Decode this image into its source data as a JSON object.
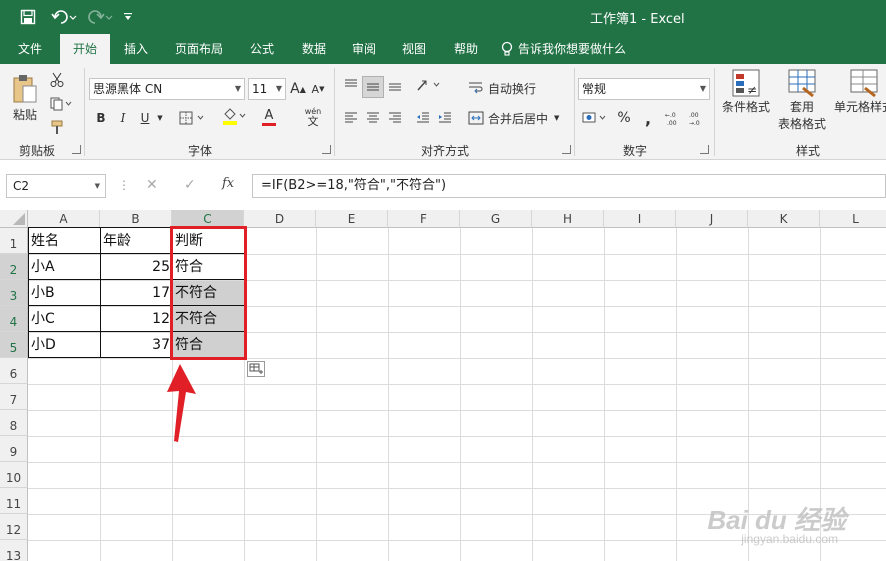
{
  "window": {
    "title": "工作簿1  -  Excel",
    "accent": "#217346",
    "highlight": "#e01f27"
  },
  "tabs": [
    "文件",
    "开始",
    "插入",
    "页面布局",
    "公式",
    "数据",
    "审阅",
    "视图",
    "帮助"
  ],
  "tell_me": "告诉我你想要做什么",
  "ribbon": {
    "clipboard": {
      "paste": "粘贴",
      "group": "剪贴板"
    },
    "font": {
      "name": "思源黑体 CN",
      "size": "11",
      "bold": "B",
      "italic": "I",
      "underline": "U",
      "group": "字体",
      "grow": "A",
      "shrink": "A",
      "pinyin": "wén",
      "font_color_letter": "A"
    },
    "alignment": {
      "wrap": "自动换行",
      "merge": "合并后居中",
      "group": "对齐方式"
    },
    "number": {
      "format": "常规",
      "percent": "%",
      "comma": ",",
      "dec_inc": ".0→.00",
      "dec_dec": ".00→.0",
      "group": "数字"
    },
    "styles": {
      "conditional": "条件格式",
      "table_format_1": "套用",
      "table_format_2": "表格格式",
      "cell_style": "单元格样式",
      "group": "样式"
    }
  },
  "formula_bar": {
    "cell": "C2",
    "formula": "=IF(B2>=18,\"符合\",\"不符合\")",
    "fx": "fx",
    "cancel": "✕",
    "enter": "✓"
  },
  "columns": [
    "A",
    "B",
    "C",
    "D",
    "E",
    "F",
    "G",
    "H",
    "I",
    "J",
    "K",
    "L"
  ],
  "rows": [
    "1",
    "2",
    "3",
    "4",
    "5",
    "6",
    "7",
    "8",
    "9",
    "10",
    "11",
    "12",
    "13"
  ],
  "table": {
    "headers": [
      "姓名",
      "年龄",
      "判断"
    ],
    "data": [
      [
        "小A",
        "25",
        "符合"
      ],
      [
        "小B",
        "17",
        "不符合"
      ],
      [
        "小C",
        "12",
        "不符合"
      ],
      [
        "小D",
        "37",
        "符合"
      ]
    ]
  },
  "watermark": {
    "brand": "Bai du 经验",
    "url": "jingyan.baidu.com"
  }
}
